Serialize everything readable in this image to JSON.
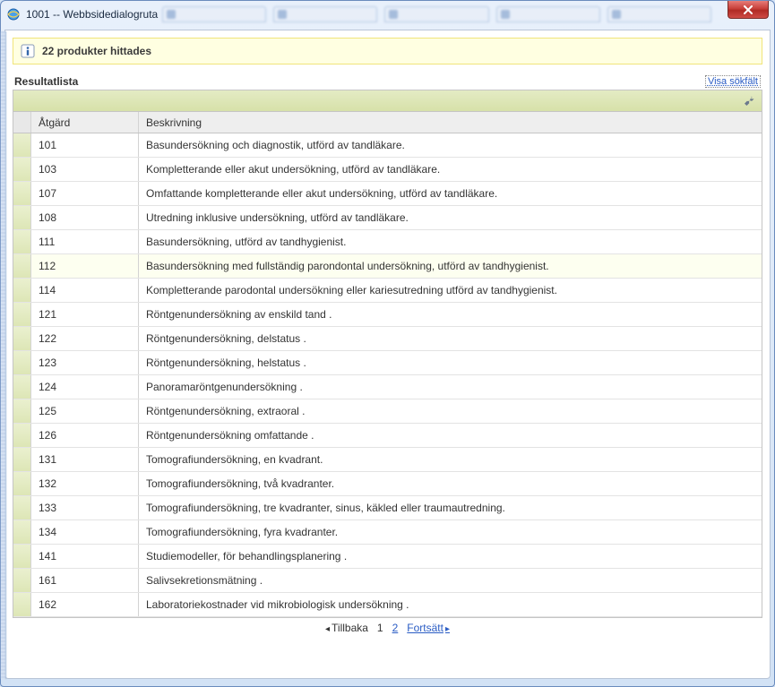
{
  "window": {
    "title": "1001 -- Webbsidedialogruta"
  },
  "banner": {
    "message": "22 produkter hittades"
  },
  "list": {
    "title": "Resultatlista",
    "show_search": "Visa sökfält",
    "columns": {
      "atgard": "Åtgärd",
      "beskrivning": "Beskrivning"
    },
    "rows": [
      {
        "atgard": "101",
        "beskr": "Basundersökning och diagnostik, utförd av tandläkare."
      },
      {
        "atgard": "103",
        "beskr": "Kompletterande eller akut undersökning, utförd av tandläkare."
      },
      {
        "atgard": "107",
        "beskr": "Omfattande kompletterande eller akut undersökning, utförd av tandläkare."
      },
      {
        "atgard": "108",
        "beskr": "Utredning inklusive undersökning, utförd av tandläkare."
      },
      {
        "atgard": "111",
        "beskr": "Basundersökning, utförd av tandhygienist."
      },
      {
        "atgard": "112",
        "beskr": "Basundersökning med fullständig parondontal undersökning, utförd av tandhygienist."
      },
      {
        "atgard": "114",
        "beskr": "Kompletterande parodontal undersökning eller kariesutredning utförd av tandhygienist."
      },
      {
        "atgard": "121",
        "beskr": "Röntgenundersökning av enskild tand     ."
      },
      {
        "atgard": "122",
        "beskr": "Röntgenundersökning, delstatus     ."
      },
      {
        "atgard": "123",
        "beskr": "Röntgenundersökning, helstatus     ."
      },
      {
        "atgard": "124",
        "beskr": "Panoramaröntgenundersökning     ."
      },
      {
        "atgard": "125",
        "beskr": "Röntgenundersökning, extraoral     ."
      },
      {
        "atgard": "126",
        "beskr": "Röntgenundersökning omfattande     ."
      },
      {
        "atgard": "131",
        "beskr": "Tomografiundersökning, en kvadrant."
      },
      {
        "atgard": "132",
        "beskr": "Tomografiundersökning, två kvadranter."
      },
      {
        "atgard": "133",
        "beskr": "Tomografiundersökning, tre kvadranter, sinus, käkled eller traumautredning."
      },
      {
        "atgard": "134",
        "beskr": "Tomografiundersökning, fyra kvadranter."
      },
      {
        "atgard": "141",
        "beskr": "Studiemodeller, för behandlingsplanering     ."
      },
      {
        "atgard": "161",
        "beskr": "Salivsekretionsmätning     ."
      },
      {
        "atgard": "162",
        "beskr": "Laboratoriekostnader vid mikrobiologisk undersökning     ."
      }
    ],
    "highlight_index": 5
  },
  "pager": {
    "prev": "Tillbaka",
    "next": "Fortsätt",
    "current": "1",
    "other": "2"
  }
}
